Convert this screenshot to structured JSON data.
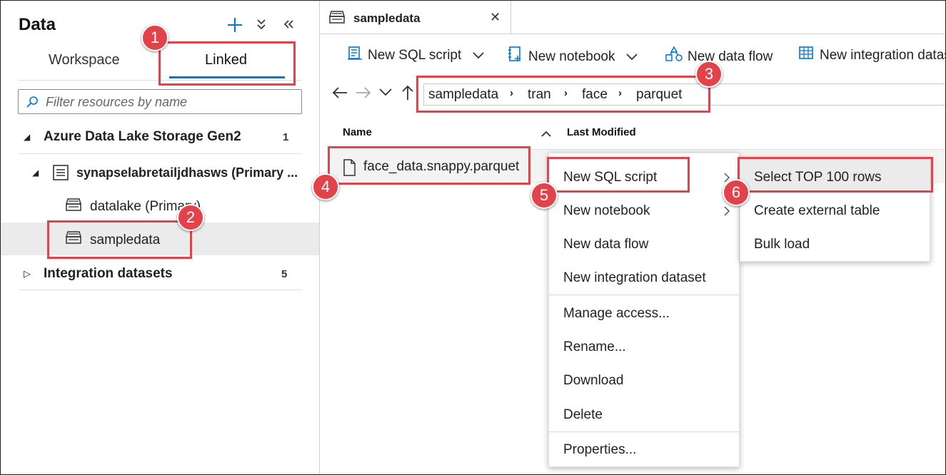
{
  "panel": {
    "title": "Data",
    "tabs": {
      "workspace": "Workspace",
      "linked": "Linked"
    },
    "filter_placeholder": "Filter resources by name"
  },
  "tree": {
    "group1": {
      "label": "Azure Data Lake Storage Gen2",
      "count": "1"
    },
    "account": {
      "label": "synapselabretailjdhasws (Primary ..."
    },
    "datalake": {
      "label": "datalake (Primary)"
    },
    "sampledata": {
      "label": "sampledata"
    },
    "group2": {
      "label": "Integration datasets",
      "count": "5"
    }
  },
  "doc_tab": {
    "label": "sampledata"
  },
  "toolbar": {
    "new_sql_script": "New SQL script",
    "new_notebook": "New notebook",
    "new_data_flow": "New data flow",
    "new_integration_dataset": "New integration dataset"
  },
  "breadcrumb": [
    "sampledata",
    "tran",
    "face",
    "parquet"
  ],
  "columns": {
    "name": "Name",
    "last_modified": "Last Modified"
  },
  "file": {
    "name": "face_data.snappy.parquet"
  },
  "context_menu": [
    "New SQL script",
    "New notebook",
    "New data flow",
    "New integration dataset",
    "Manage access...",
    "Rename...",
    "Download",
    "Delete",
    "Properties..."
  ],
  "submenu": [
    "Select TOP 100 rows",
    "Create external table",
    "Bulk load"
  ],
  "badges": [
    "1",
    "2",
    "3",
    "4",
    "5",
    "6"
  ],
  "colors": {
    "accent": "#0078d4",
    "callout": "#e2434b"
  }
}
